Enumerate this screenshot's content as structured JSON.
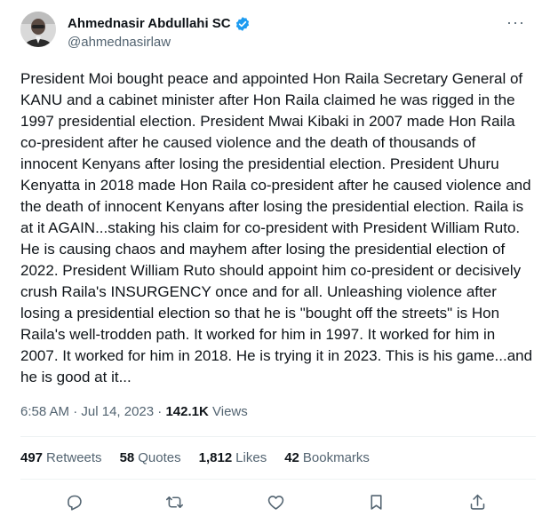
{
  "author": {
    "display_name": "Ahmednasir Abdullahi SC",
    "handle": "@ahmednasirlaw",
    "verified_icon": "verified-badge-icon",
    "accent_color": "#1d9bf0"
  },
  "menu": {
    "more_glyph": "···"
  },
  "tweet": {
    "text": "President Moi bought peace and appointed Hon Raila Secretary General of KANU and a cabinet minister after Hon Raila claimed he was rigged in the 1997 presidential election. President Mwai Kibaki in 2007 made Hon Raila co-president after he caused violence and the death of thousands of innocent Kenyans after losing the presidential election. President Uhuru Kenyatta in 2018 made Hon Raila co-president after he caused violence and the death of innocent Kenyans after losing the presidential election. Raila is at it AGAIN...staking his claim for co-president with President William Ruto. He is causing chaos and mayhem after losing the presidential election of 2022. President William Ruto should appoint him co-president or decisively crush Raila's INSURGENCY once and for all. Unleashing violence after losing a presidential election so that he is \"bought off the streets\" is Hon Raila's well-trodden path. It worked for him in 1997. It worked for him in 2007. It worked for him in 2018. He is trying it in 2023. This is his game...and he is good at it...",
    "time": "6:58 AM",
    "separator": " · ",
    "date": "Jul 14, 2023",
    "views_count": "142.1K",
    "views_label": "Views"
  },
  "stats": [
    {
      "count": "497",
      "label": "Retweets"
    },
    {
      "count": "58",
      "label": "Quotes"
    },
    {
      "count": "1,812",
      "label": "Likes"
    },
    {
      "count": "42",
      "label": "Bookmarks"
    }
  ],
  "actions": [
    "reply-icon",
    "retweet-icon",
    "like-icon",
    "bookmark-icon",
    "share-icon"
  ]
}
